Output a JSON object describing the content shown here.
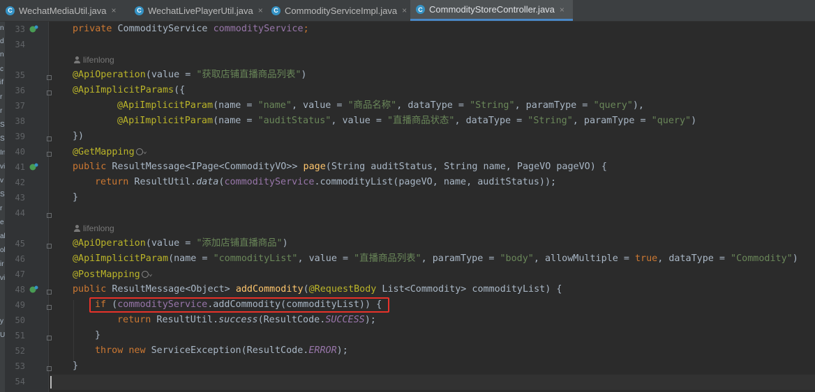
{
  "tabs": [
    {
      "label": "WechatMediaUtil.java",
      "icon": "C",
      "active": false
    },
    {
      "label": "WechatLivePlayerUtil.java",
      "icon": "C",
      "active": false
    },
    {
      "label": "CommodityServiceImpl.java",
      "icon": "C",
      "active": false
    },
    {
      "label": "CommodityStoreController.java",
      "icon": "C",
      "active": true
    }
  ],
  "tab_close_glyph": "×",
  "left_strip_chars": [
    "n",
    "d",
    "n",
    "c",
    "if",
    "r",
    "r",
    "S",
    "S",
    "In",
    "vi",
    "v",
    "S",
    "r",
    "e",
    "al",
    "ol",
    "ir",
    "vi",
    "",
    "y",
    "U"
  ],
  "line_numbers": [
    "33",
    "34",
    "35",
    "36",
    "37",
    "38",
    "39",
    "40",
    "41",
    "42",
    "43",
    "44",
    "45",
    "46",
    "47",
    "48",
    "49",
    "50",
    "51",
    "52",
    "53",
    "54"
  ],
  "authors": {
    "first": "lifenlong",
    "second": "lifenlong"
  },
  "code": {
    "l33": [
      "private",
      "CommodityService",
      "commodityService",
      ";"
    ],
    "l35": [
      "@ApiOperation",
      "(value = ",
      "\"获取店铺直播商品列表\"",
      ")"
    ],
    "l36": [
      "@ApiImplicitParams",
      "({"
    ],
    "l37": [
      "@ApiImplicitParam",
      "(name = ",
      "\"name\"",
      ", value = ",
      "\"商品名称\"",
      ", dataType = ",
      "\"String\"",
      ", paramType = ",
      "\"query\"",
      "),"
    ],
    "l38": [
      "@ApiImplicitParam",
      "(name = ",
      "\"auditStatus\"",
      ", value = ",
      "\"直播商品状态\"",
      ", dataType = ",
      "\"String\"",
      ", paramType = ",
      "\"query\"",
      ")"
    ],
    "l39": [
      "})"
    ],
    "l40": [
      "@GetMapping"
    ],
    "l41": [
      "public",
      " ResultMessage<IPage<CommodityVO>> ",
      "page",
      "(String auditStatus, String name, PageVO pageVO) {"
    ],
    "l42": [
      "return",
      " ResultUtil.",
      "data",
      "(",
      "commodityService",
      ".commodityList(pageVO, name, auditStatus));"
    ],
    "l43": [
      "}"
    ],
    "l45": [
      "@ApiOperation",
      "(value = ",
      "\"添加店铺直播商品\"",
      ")"
    ],
    "l46": [
      "@ApiImplicitParam",
      "(name = ",
      "\"commodityList\"",
      ", value = ",
      "\"直播商品列表\"",
      ", paramType = ",
      "\"body\"",
      ", allowMultiple = ",
      "true",
      ", dataType = ",
      "\"Commodity\"",
      ")"
    ],
    "l47": [
      "@PostMapping"
    ],
    "l48": [
      "public",
      " ResultMessage<Object> ",
      "addCommodity",
      "(",
      "@RequestBody",
      " List<Commodity> commodityList) {"
    ],
    "l49": [
      "if",
      " (",
      "commodityService",
      ".addCommodity(commodityList)) {"
    ],
    "l50": [
      "return",
      " ResultUtil.",
      "success",
      "(ResultCode.",
      "SUCCESS",
      ");"
    ],
    "l51": [
      "}"
    ],
    "l52": [
      "throw",
      " ",
      "new",
      " ServiceException(ResultCode.",
      "ERROR",
      ");"
    ],
    "l53": [
      "}"
    ]
  },
  "colors": {
    "keyword": "#cc7832",
    "annotation": "#bbb529",
    "string": "#6a8759",
    "field": "#9876aa",
    "method": "#ffc66d",
    "highlight_box": "#e8322a"
  }
}
